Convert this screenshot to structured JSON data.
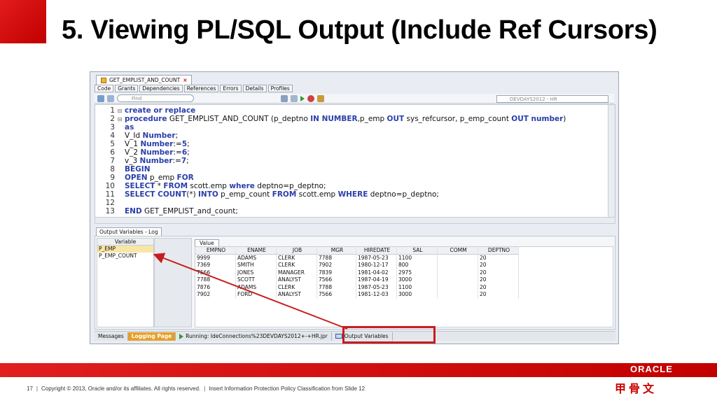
{
  "slide": {
    "title": "5. Viewing PL/SQL Output (Include Ref Cursors)",
    "brand_red": "#c10000"
  },
  "ide": {
    "doc_tab": "GET_EMPLIST_AND_COUNT",
    "doc_tab_close": "×",
    "subtabs": [
      "Code",
      "Grants",
      "Dependencies",
      "References",
      "Errors",
      "Details",
      "Profiles"
    ],
    "find_placeholder": "Find",
    "connection": "DEVDAYS2012 - HR",
    "code": [
      {
        "n": "1",
        "fold": "⊟",
        "parts": [
          {
            "t": "create or replace",
            "k": true
          }
        ]
      },
      {
        "n": "2",
        "fold": "⊟",
        "parts": [
          {
            "t": "procedure",
            "k": true
          },
          {
            "t": " GET_EMPLIST_AND_COUNT (p_deptno ",
            "k": false
          },
          {
            "t": "IN NUMBER",
            "k": true
          },
          {
            "t": ",p_emp ",
            "k": false
          },
          {
            "t": "OUT",
            "k": true
          },
          {
            "t": " sys_refcursor, p_emp_count ",
            "k": false
          },
          {
            "t": "OUT number",
            "k": true
          },
          {
            "t": ")",
            "k": false
          }
        ]
      },
      {
        "n": "3",
        "fold": "",
        "parts": [
          {
            "t": "as",
            "k": true
          }
        ]
      },
      {
        "n": "4",
        "fold": "",
        "parts": [
          {
            "t": "V_Id ",
            "k": false
          },
          {
            "t": "Number",
            "k": true
          },
          {
            "t": ";",
            "k": false
          }
        ]
      },
      {
        "n": "5",
        "fold": "",
        "parts": [
          {
            "t": "V_1 ",
            "k": false
          },
          {
            "t": "Number",
            "k": true
          },
          {
            "t": ":=",
            "k": false
          },
          {
            "t": "5",
            "k": true
          },
          {
            "t": ";",
            "k": false
          }
        ]
      },
      {
        "n": "6",
        "fold": "",
        "parts": [
          {
            "t": "V_2 ",
            "k": false
          },
          {
            "t": "Number",
            "k": true
          },
          {
            "t": ":=",
            "k": false
          },
          {
            "t": "6",
            "k": true
          },
          {
            "t": ";",
            "k": false
          }
        ]
      },
      {
        "n": "7",
        "fold": "",
        "parts": [
          {
            "t": "v_3 ",
            "k": false
          },
          {
            "t": "Number",
            "k": true
          },
          {
            "t": ":=",
            "k": false
          },
          {
            "t": "7",
            "k": true
          },
          {
            "t": ";",
            "k": false
          }
        ]
      },
      {
        "n": "8",
        "fold": "",
        "parts": [
          {
            "t": "BEGIN",
            "k": true
          }
        ]
      },
      {
        "n": "9",
        "fold": "",
        "parts": [
          {
            "t": "OPEN",
            "k": true
          },
          {
            "t": " p_emp ",
            "k": false
          },
          {
            "t": "FOR",
            "k": true
          }
        ]
      },
      {
        "n": "10",
        "fold": "",
        "parts": [
          {
            "t": "SELECT",
            "k": true
          },
          {
            "t": " * ",
            "k": false
          },
          {
            "t": "FROM",
            "k": true
          },
          {
            "t": " scott.emp ",
            "k": false
          },
          {
            "t": "where",
            "k": true
          },
          {
            "t": " deptno=p_deptno;",
            "k": false
          }
        ]
      },
      {
        "n": "11",
        "fold": "",
        "parts": [
          {
            "t": "SELECT COUNT",
            "k": true
          },
          {
            "t": "(*) ",
            "k": false
          },
          {
            "t": "INTO",
            "k": true
          },
          {
            "t": " p_emp_count ",
            "k": false
          },
          {
            "t": "FROM",
            "k": true
          },
          {
            "t": " scott.emp ",
            "k": false
          },
          {
            "t": "WHERE",
            "k": true
          },
          {
            "t": " deptno=p_deptno;",
            "k": false
          }
        ]
      },
      {
        "n": "12",
        "fold": "",
        "parts": []
      },
      {
        "n": "13",
        "fold": "",
        "parts": [
          {
            "t": "END",
            "k": true
          },
          {
            "t": " GET_EMPLIST_and_count;",
            "k": false
          }
        ]
      }
    ],
    "output_tab": "Output Variables - Log",
    "variables_header": "Variable",
    "variables": [
      "P_EMP",
      "P_EMP_COUNT"
    ],
    "value_tab": "Value",
    "grid_columns": [
      "EMPNO",
      "ENAME",
      "JOB",
      "MGR",
      "HIREDATE",
      "SAL",
      "COMM",
      "DEPTNO"
    ],
    "grid_rows": [
      [
        "9999",
        "ADAMS",
        "CLERK",
        "7788",
        "1987-05-23",
        "1100",
        "",
        "20"
      ],
      [
        "7369",
        "SMITH",
        "CLERK",
        "7902",
        "1980-12-17",
        "800",
        "",
        "20"
      ],
      [
        "7566",
        "JONES",
        "MANAGER",
        "7839",
        "1981-04-02",
        "2975",
        "",
        "20"
      ],
      [
        "7788",
        "SCOTT",
        "ANALYST",
        "7566",
        "1987-04-19",
        "3000",
        "",
        "20"
      ],
      [
        "7876",
        "ADAMS",
        "CLERK",
        "7788",
        "1987-05-23",
        "1100",
        "",
        "20"
      ],
      [
        "7902",
        "FORD",
        "ANALYST",
        "7566",
        "1981-12-03",
        "3000",
        "",
        "20"
      ]
    ],
    "status": {
      "messages": "Messages",
      "logging": "Logging Page",
      "running": "Running: IdeConnections%23DEVDAYS2012+-+HR.jpr",
      "output_vars": "Output Variables"
    }
  },
  "footer": {
    "page": "17",
    "copyright": "Copyright © 2013, Oracle and/or its affiliates. All rights reserved.",
    "classification": "Insert Information Protection Policy Classification from Slide 12",
    "oracle_logo": "ORACLE",
    "cn_logo": "甲骨文"
  }
}
